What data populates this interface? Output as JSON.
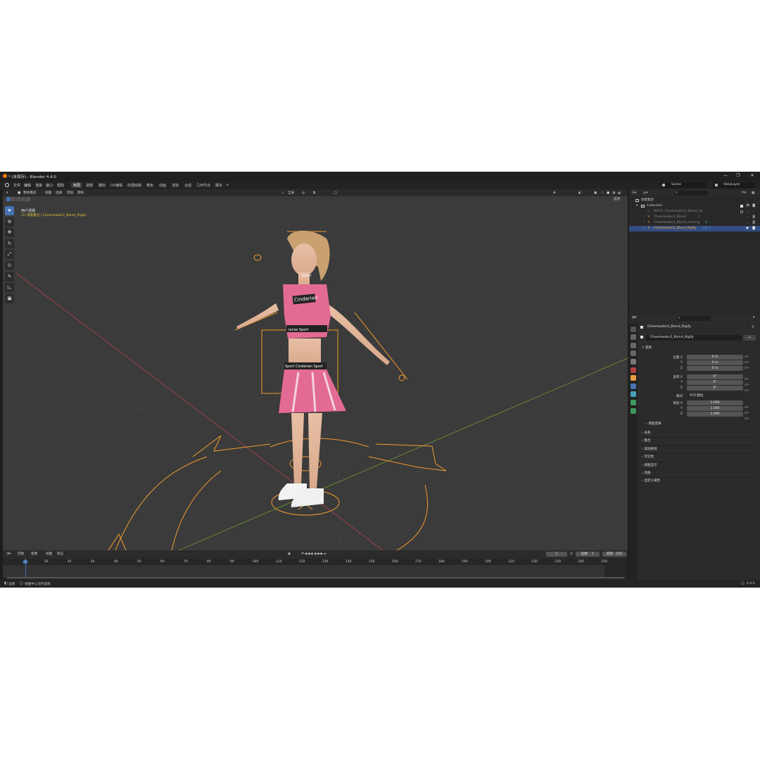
{
  "window": {
    "title": "* (未保存) - Blender 4.4.0",
    "controls": [
      "—",
      "❐",
      "✕"
    ]
  },
  "menubar": {
    "menus": [
      "文件",
      "编辑",
      "渲染",
      "窗口",
      "帮助"
    ],
    "workspaces": [
      "布局",
      "建模",
      "雕刻",
      "UV编辑",
      "纹理绘制",
      "着色",
      "动画",
      "渲染",
      "合成",
      "几何节点",
      "脚本"
    ],
    "active_workspace": "布局",
    "add_tab": "+",
    "scene": "Scene",
    "view_layer": "ViewLayer"
  },
  "viewport": {
    "mode": "物体模式",
    "menus": [
      "视图",
      "选择",
      "添加",
      "物体"
    ],
    "transform_orientation": "全局",
    "options_label": "选项",
    "overlay_title": "用户透视",
    "overlay_subtitle": "(1) 场景集合 | Cheerleader2_Blend_Rigify",
    "tools": [
      "select-tool",
      "cursor-tool",
      "move-tool",
      "rotate-tool",
      "scale-tool",
      "transform-tool",
      "annotate-tool",
      "measure-tool",
      "add-cube-tool"
    ],
    "shirt_text": "Cindarian",
    "band_text_top": "ianse Sport",
    "band_text_skirt": "Sport Cindarian Sport",
    "neck_text": "pport"
  },
  "timeline": {
    "menus": [
      "回放",
      "抠像",
      "视图",
      "标记"
    ],
    "current_frame": "1",
    "start_label": "起始",
    "start": "1",
    "end_label": "结束",
    "end": "250",
    "ticks": [
      "1",
      "10",
      "20",
      "30",
      "40",
      "50",
      "60",
      "70",
      "80",
      "90",
      "100",
      "110",
      "120",
      "130",
      "140",
      "150",
      "160",
      "170",
      "180",
      "190",
      "200",
      "210",
      "220",
      "230",
      "240",
      "250"
    ]
  },
  "statusbar": {
    "left_hint_1": "选择",
    "left_hint_2": "视图中心对齐鼠标",
    "version": "4.4.0"
  },
  "outliner": {
    "search_placeholder": "",
    "rows": [
      {
        "label": "场景集合",
        "indent": 0
      },
      {
        "label": "Collection",
        "indent": 1
      },
      {
        "label": "WGTS_Cheerleader2_Blend_rig",
        "indent": 2
      },
      {
        "label": "Cheerleader2_Blend",
        "indent": 2
      },
      {
        "label": "Cheerleader2_Blend_metarig",
        "indent": 2
      },
      {
        "label": "Cheerleader2_Blend_Rigify",
        "indent": 2,
        "selected": true
      }
    ]
  },
  "properties": {
    "search_placeholder": "",
    "object_name": "Cheerleader2_Blend_Rigify",
    "data_name": "Cheerleader2_Blend_Rigify",
    "transform_header": "变换",
    "location_label": "位置 X",
    "location": [
      "0 m",
      "0 m",
      "0 m"
    ],
    "rotation_label": "旋转 X",
    "rotation": [
      "0°",
      "0°",
      "0°"
    ],
    "mode_label": "模式",
    "mode_value": "XYZ 欧拉",
    "scale_label": "缩放 X",
    "scale": [
      "1.000",
      "1.000",
      "1.000"
    ],
    "axis_y": "Y",
    "axis_z": "Z",
    "delta_label": "增量变换",
    "sections": [
      "关系",
      "集合",
      "运动路径",
      "可见性",
      "视图显示",
      "动画",
      "自定义属性"
    ]
  },
  "colors": {
    "accent_blue": "#4772b3",
    "selection_orange": "#f29a2e",
    "axis_red": "#b3414a",
    "axis_green": "#6e9a32",
    "frame_indicator": "#4772b3"
  }
}
